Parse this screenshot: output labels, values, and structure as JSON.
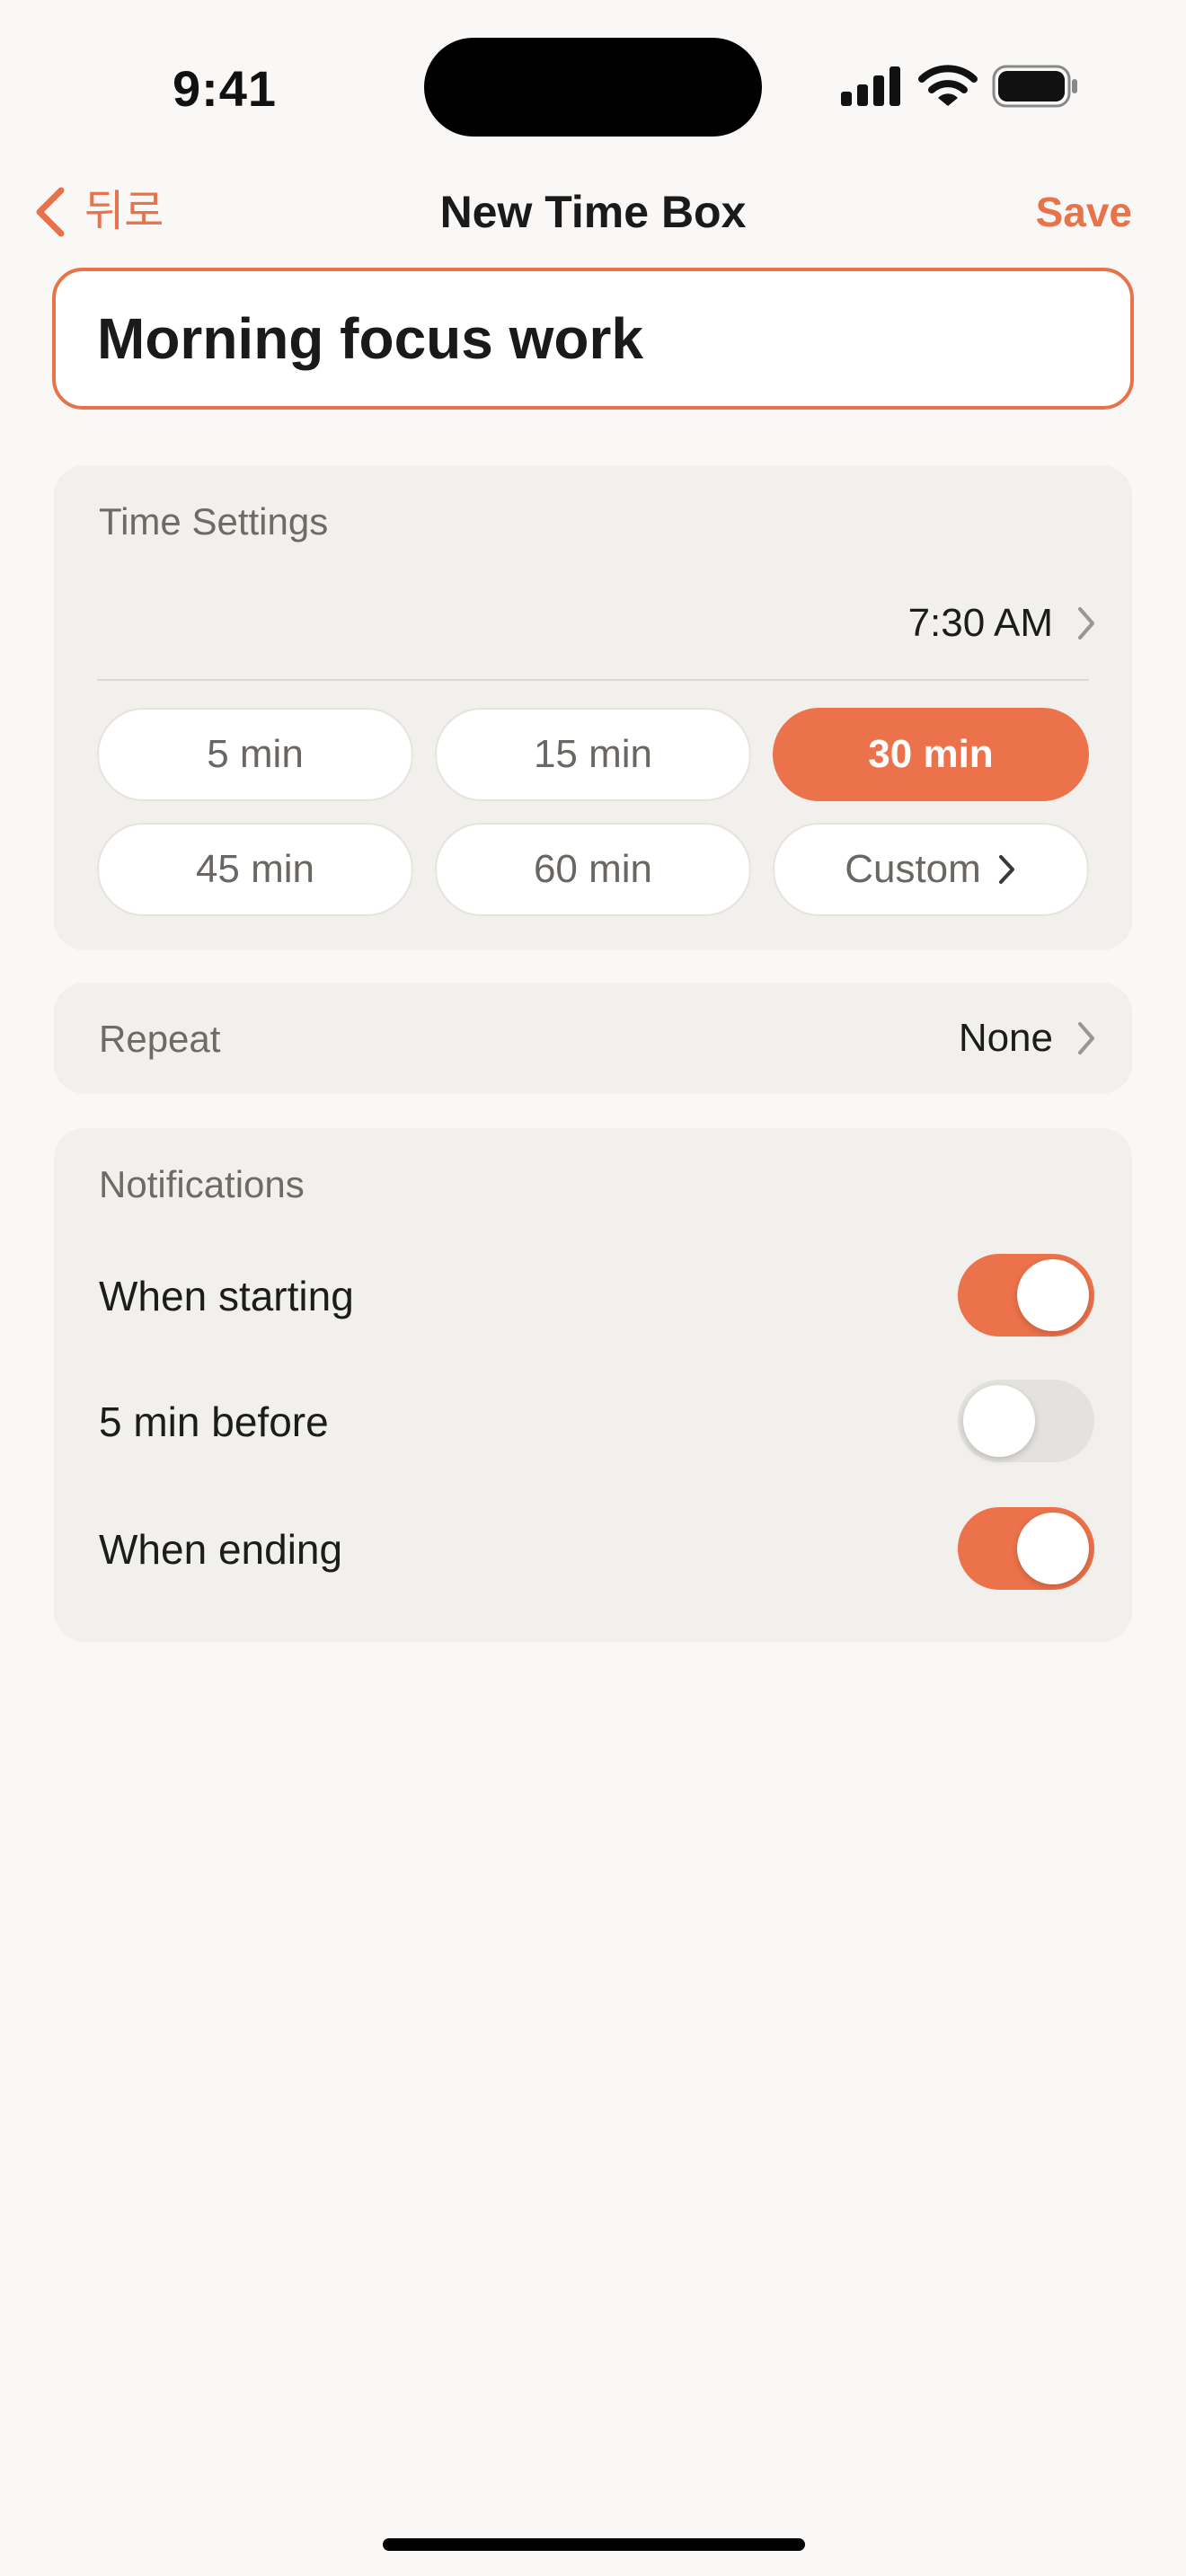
{
  "status_bar": {
    "time": "9:41",
    "icons": [
      "signal-icon",
      "wifi-icon",
      "battery-icon"
    ]
  },
  "nav": {
    "back_label": "뒤로",
    "title": "New Time Box",
    "save_label": "Save"
  },
  "title_input": {
    "value": "Morning focus work"
  },
  "time_settings": {
    "label": "Time Settings",
    "start_time": "7:30 AM",
    "durations": [
      "5 min",
      "15 min",
      "30 min",
      "45 min",
      "60 min",
      "Custom"
    ],
    "selected_duration": "30 min"
  },
  "repeat": {
    "label": "Repeat",
    "value": "None"
  },
  "notifications": {
    "label": "Notifications",
    "items": [
      {
        "label": "When starting",
        "enabled": true
      },
      {
        "label": "5 min before",
        "enabled": false
      },
      {
        "label": "When ending",
        "enabled": true
      }
    ]
  },
  "colors": {
    "accent": "#ec724b",
    "background": "#f9f8f6",
    "card": "#f2f0ec"
  }
}
